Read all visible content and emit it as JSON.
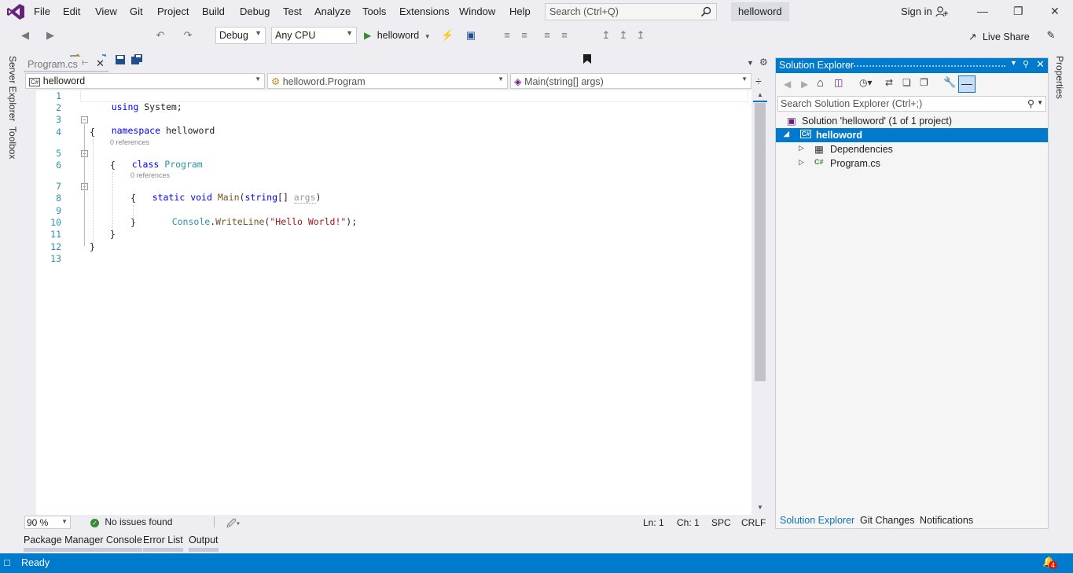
{
  "window": {
    "menu": [
      "File",
      "Edit",
      "View",
      "Git",
      "Project",
      "Build",
      "Debug",
      "Test",
      "Analyze",
      "Tools",
      "Extensions",
      "Window",
      "Help"
    ],
    "search_placeholder": "Search (Ctrl+Q)",
    "solution_name": "helloword",
    "sign_in": "Sign in"
  },
  "toolbar": {
    "configuration": "Debug",
    "platform": "Any CPU",
    "run_target": "helloword",
    "live_share": "Live Share"
  },
  "left_rail": [
    "Server Explorer",
    "Toolbox"
  ],
  "right_rail": [
    "Properties"
  ],
  "editor": {
    "tab_title": "Program.cs",
    "nav": {
      "project": "helloword",
      "type": "helloword.Program",
      "member": "Main(string[] args)"
    },
    "lines": [
      {
        "n": "1"
      },
      {
        "n": "2"
      },
      {
        "n": "3"
      },
      {
        "n": "4"
      },
      {
        "n": "5"
      },
      {
        "n": "6"
      },
      {
        "n": "7"
      },
      {
        "n": "8"
      },
      {
        "n": "9"
      },
      {
        "n": "10"
      },
      {
        "n": "11"
      },
      {
        "n": "12"
      },
      {
        "n": "13"
      }
    ],
    "code": {
      "l1_kw": "using",
      "l1_rest": " System;",
      "l3_kw": "namespace",
      "l3_rest": " helloword",
      "open_brace": "{",
      "close_brace": "}",
      "refs_class": "0 references",
      "l5_kw": "class",
      "l5_type": "Program",
      "refs_method": "0 references",
      "l7_kw1": "static",
      "l7_kw2": "void",
      "l7_fn": "Main",
      "l7_open": "(",
      "l7_kw3": "string",
      "l7_rest": "[] ",
      "l7_arg": "args",
      "l7_close": ")",
      "l9_type": "Console",
      "l9_dot": ".",
      "l9_fn": "WriteLine",
      "l9_open": "(",
      "l9_str": "\"Hello World!\"",
      "l9_close": ");"
    },
    "status": {
      "zoom": "90 %",
      "issues": "No issues found",
      "ln": "Ln: 1",
      "ch": "Ch: 1",
      "spc": "SPC",
      "eol": "CRLF"
    }
  },
  "bottom_tabs": [
    "Package Manager Console",
    "Error List",
    "Output"
  ],
  "statusbar": {
    "ready": "Ready",
    "notifications_count": "4"
  },
  "solution_explorer": {
    "title": "Solution Explorer",
    "search_placeholder": "Search Solution Explorer (Ctrl+;)",
    "tree": [
      {
        "label": "Solution 'helloword' (1 of 1 project)"
      },
      {
        "label": "helloword"
      },
      {
        "label": "Dependencies"
      },
      {
        "label": "Program.cs"
      }
    ],
    "tabs": [
      "Solution Explorer",
      "Git Changes",
      "Notifications"
    ]
  },
  "colors": {
    "accent": "#007acc",
    "keyword": "#0000ff",
    "type": "#2b91af",
    "string": "#a31515",
    "vs_purple": "#68217a"
  }
}
